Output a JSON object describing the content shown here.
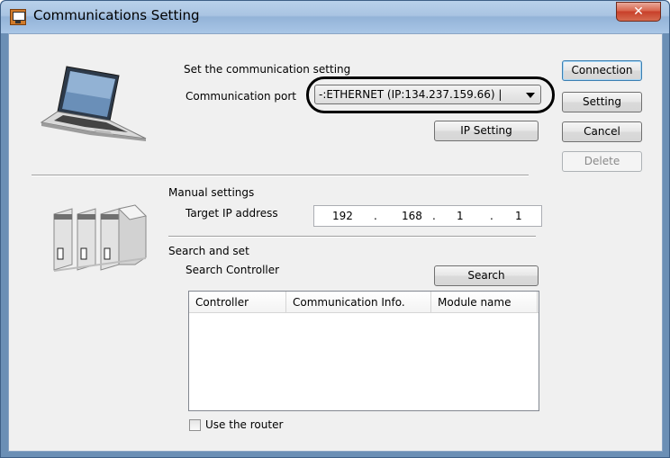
{
  "window": {
    "title": "Communications Setting",
    "close_label": "✕"
  },
  "connection": {
    "heading": "Set the communication setting",
    "port_label": "Communication port",
    "port_value": "-:ETHERNET  (IP:134.237.159.66) |",
    "ip_setting_button": "IP Setting"
  },
  "manual": {
    "heading": "Manual settings",
    "target_ip_label": "Target IP address",
    "ip_octets": [
      "192",
      "168",
      "1",
      "1"
    ],
    "dot": "."
  },
  "search": {
    "heading": "Search and set",
    "controller_label": "Search Controller",
    "search_button": "Search",
    "columns": [
      "Controller",
      "Communication Info.",
      "Module name"
    ],
    "use_router_label": "Use the router",
    "use_router_checked": false
  },
  "side_buttons": {
    "connection": "Connection",
    "setting": "Setting",
    "cancel": "Cancel",
    "delete": "Delete"
  },
  "icons": {
    "title": "app-icon",
    "laptop": "laptop-icon",
    "controller": "plc-controller-icon"
  }
}
